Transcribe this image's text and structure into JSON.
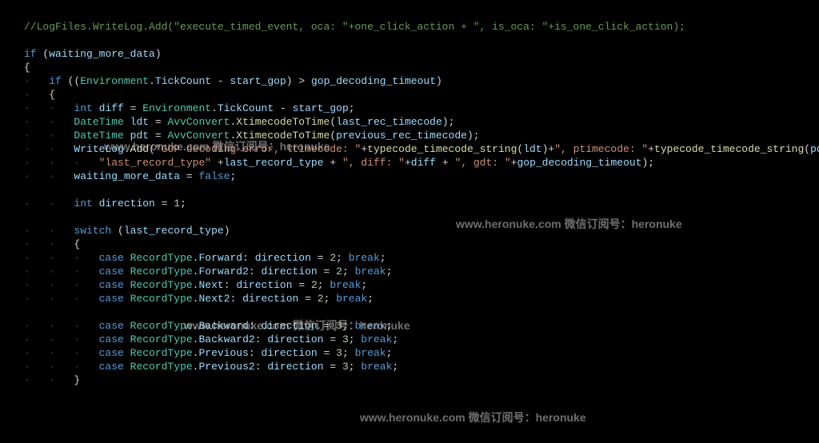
{
  "code": {
    "line1_comment": "//LogFiles.WriteLog.Add(\"execute_timed_event, oca: \"+one_click_action + \", is_oca: \"+is_one_click_action);",
    "if1": "if",
    "waitvar": "waiting_more_data",
    "brace_open1": "{",
    "if2": "if",
    "env": "Environment",
    "tick": "TickCount",
    "startgop": "start_gop",
    "gopvar": "gop_decoding_timeout",
    "brace_open2": "{",
    "inttype": "int",
    "diffvar": "diff",
    "eq": " = ",
    "startgop2": "start_gop",
    "datetime": "DateTime",
    "ldtvar": "ldt",
    "avv": "AvvConvert",
    "xttt": "XtimecodeToTime",
    "lrt": "last_rec_timecode",
    "pdtvar": "pdt",
    "prt": "previous_rec_timecode",
    "wl": "WriteLog",
    "add": "Add",
    "str1": "\"GOP decoding error, ltimecode: \"",
    "tcts": "typecode_timecode_string",
    "str2": "\", ptimecode: \"",
    "str3": "\"last_record_type\"",
    "lrtv": "last_record_type",
    "str4": "\", diff: \"",
    "str5": "\", gdt: \"",
    "false": "false",
    "direction": "direction",
    "n1": "1",
    "n2": "2",
    "n3": "3",
    "switch": "switch",
    "case": "case",
    "rt": "RecordType",
    "fwd": "Forward",
    "fwd2": "Forward2",
    "next": "Next",
    "next2": "Next2",
    "bwd": "Backward",
    "bwd2": "Backward2",
    "prev": "Previous",
    "prev2": "Previous2",
    "break": "break",
    "brace_close1": "}",
    "brace_close2": "}"
  },
  "watermarks": {
    "text1": "www.heronuke.com  微信订阅号：heronuke",
    "text2": "www.heronuke.com  微信订阅号：heronuke",
    "text3": "www.heronuke.com  微信订阅号：heronuke",
    "text4": "www.heronuke.com  微信订阅号：heronuke"
  }
}
